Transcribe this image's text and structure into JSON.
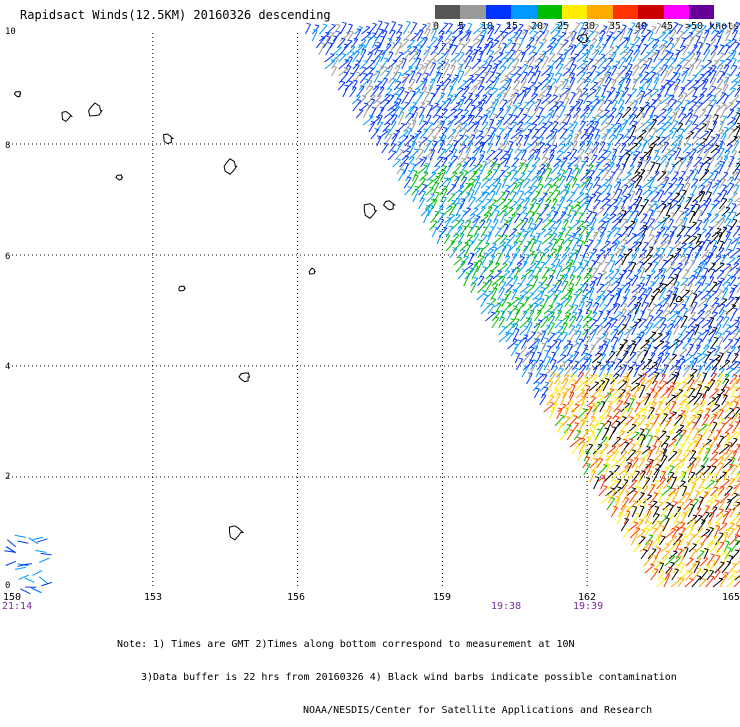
{
  "header": {
    "title": "Rapidsact Winds(12.5KM) 20160326 descending"
  },
  "legend": {
    "labels": [
      "0",
      "5",
      "10",
      "15",
      "20",
      "25",
      "30",
      "35",
      "40",
      "45",
      ">50 knots"
    ],
    "colors": [
      "#555555",
      "#9a9a9a",
      "#0033ff",
      "#0099ff",
      "#00bb00",
      "#ffee00",
      "#ffaa00",
      "#ff3300",
      "#cc0000",
      "#ff00ff",
      "#660099"
    ],
    "contamination_color": "#000000"
  },
  "axes": {
    "x_ticks": [
      "150",
      "153",
      "156",
      "159",
      "162",
      "165"
    ],
    "y_ticks": [
      "0",
      "2",
      "4",
      "6",
      "8",
      "10"
    ]
  },
  "times": {
    "left": "21:14",
    "mid1": "19:38",
    "mid2": "19:39"
  },
  "notes": {
    "line1": "Note: 1) Times are GMT 2)Times along bottom correspond to measurement at 10N",
    "line2": "3)Data buffer is 22 hrs from 20160326 4) Black wind barbs indicate possible contamination",
    "line3": "NOAA/NESDIS/Center for Satellite Applications and Research"
  },
  "map_data": {
    "lon_range": [
      150,
      165
    ],
    "lat_range": [
      0,
      10
    ],
    "islands": [
      {
        "lon": 150.2,
        "lat": 8.9
      },
      {
        "lon": 151.2,
        "lat": 8.5
      },
      {
        "lon": 151.8,
        "lat": 8.6
      },
      {
        "lon": 152.3,
        "lat": 7.4
      },
      {
        "lon": 153.3,
        "lat": 8.1
      },
      {
        "lon": 154.6,
        "lat": 7.6
      },
      {
        "lon": 153.6,
        "lat": 5.4
      },
      {
        "lon": 157.9,
        "lat": 6.9
      },
      {
        "lon": 157.5,
        "lat": 6.8
      },
      {
        "lon": 156.3,
        "lat": 5.7
      },
      {
        "lon": 154.9,
        "lat": 3.8
      },
      {
        "lon": 154.7,
        "lat": 1.0
      },
      {
        "lon": 163.9,
        "lat": 5.2
      },
      {
        "lon": 161.9,
        "lat": 9.9
      }
    ]
  }
}
